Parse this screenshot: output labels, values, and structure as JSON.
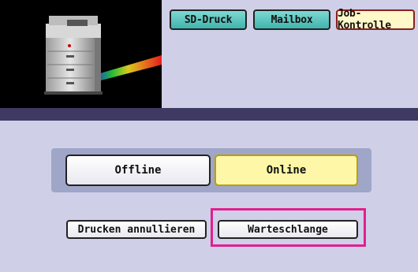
{
  "header": {
    "tabs": [
      {
        "label": "SD-Druck",
        "active": false
      },
      {
        "label": "Mailbox",
        "active": false
      },
      {
        "label": "Job-Kontrolle",
        "active": true
      }
    ]
  },
  "main": {
    "offline_label": "Offline",
    "online_label": "Online",
    "cancel_print_label": "Drucken annullieren",
    "queue_label": "Warteschlange"
  },
  "colors": {
    "background": "#cfcfe8",
    "band": "#3e3a63",
    "tab_teal": "#3fb5ae",
    "online_selected": "#fff7a8",
    "highlight": "#e0208e"
  },
  "icons": {
    "printer": "printer-image"
  }
}
